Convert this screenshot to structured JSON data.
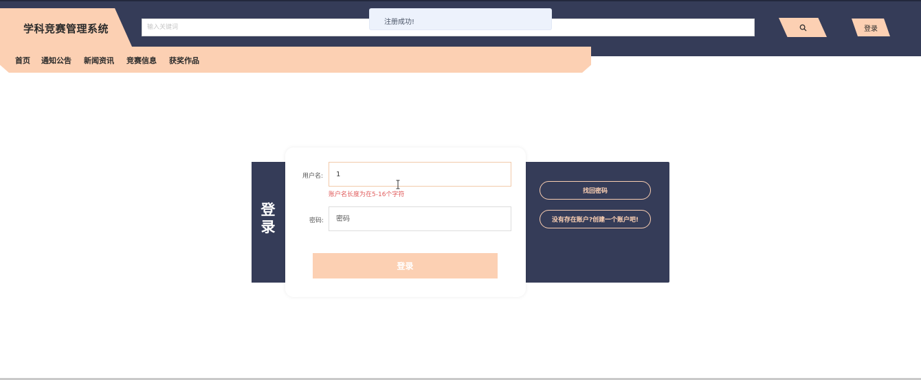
{
  "header": {
    "title": "学科竞赛管理系统",
    "search_placeholder": "输入关键词",
    "search_icon": "search-icon",
    "login_label": "登录"
  },
  "nav": {
    "items": [
      "首页",
      "通知公告",
      "新闻资讯",
      "竞赛信息",
      "获奖作品"
    ]
  },
  "toast": {
    "message": "注册成功!"
  },
  "login_form": {
    "side_title_1": "登",
    "side_title_2": "录",
    "username_label": "用户名:",
    "username_value": "1",
    "username_error": "账户名长度为在5-16个字符",
    "password_label": "密码:",
    "password_placeholder": "密码",
    "submit_label": "登录"
  },
  "side_links": {
    "forgot_password": "找回密码",
    "register": "没有存在账户?创建一个账户吧!"
  },
  "colors": {
    "dark": "#353c58",
    "accent": "#fcd0b3",
    "error": "#e05a5a"
  }
}
